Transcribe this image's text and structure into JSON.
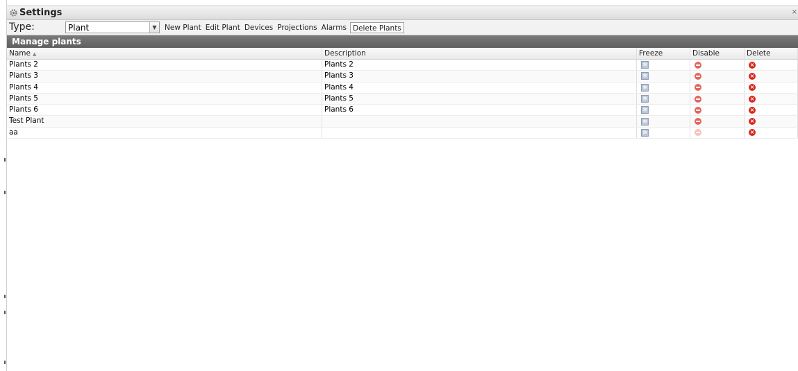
{
  "window": {
    "title": "Settings",
    "close_label": "×"
  },
  "toolbar": {
    "type_label": "Type:",
    "type_select_value": "Plant",
    "buttons": [
      "New Plant",
      "Edit Plant",
      "Devices",
      "Projections",
      "Alarms",
      "Delete Plants"
    ]
  },
  "panel": {
    "title": "Manage plants"
  },
  "grid": {
    "columns": [
      "Name",
      "Description",
      "Freeze",
      "Disable",
      "Delete"
    ],
    "sort_indicator": "▲",
    "rows": [
      {
        "name": "Plants 2",
        "description": "Plants 2",
        "disable_enabled": true
      },
      {
        "name": "Plants 3",
        "description": "Plants 3",
        "disable_enabled": true
      },
      {
        "name": "Plants 4",
        "description": "Plants 4",
        "disable_enabled": true
      },
      {
        "name": "Plants 5",
        "description": "Plants 5",
        "disable_enabled": true
      },
      {
        "name": "Plants 6",
        "description": "Plants 6",
        "disable_enabled": true
      },
      {
        "name": "Test Plant",
        "description": "",
        "disable_enabled": true
      },
      {
        "name": "aa",
        "description": "",
        "disable_enabled": false
      }
    ]
  },
  "colors": {
    "panel_header": "#666666",
    "disable_icon": "#e2665c",
    "delete_icon": "#d8261c",
    "freeze_icon": "#b9c4d4"
  }
}
